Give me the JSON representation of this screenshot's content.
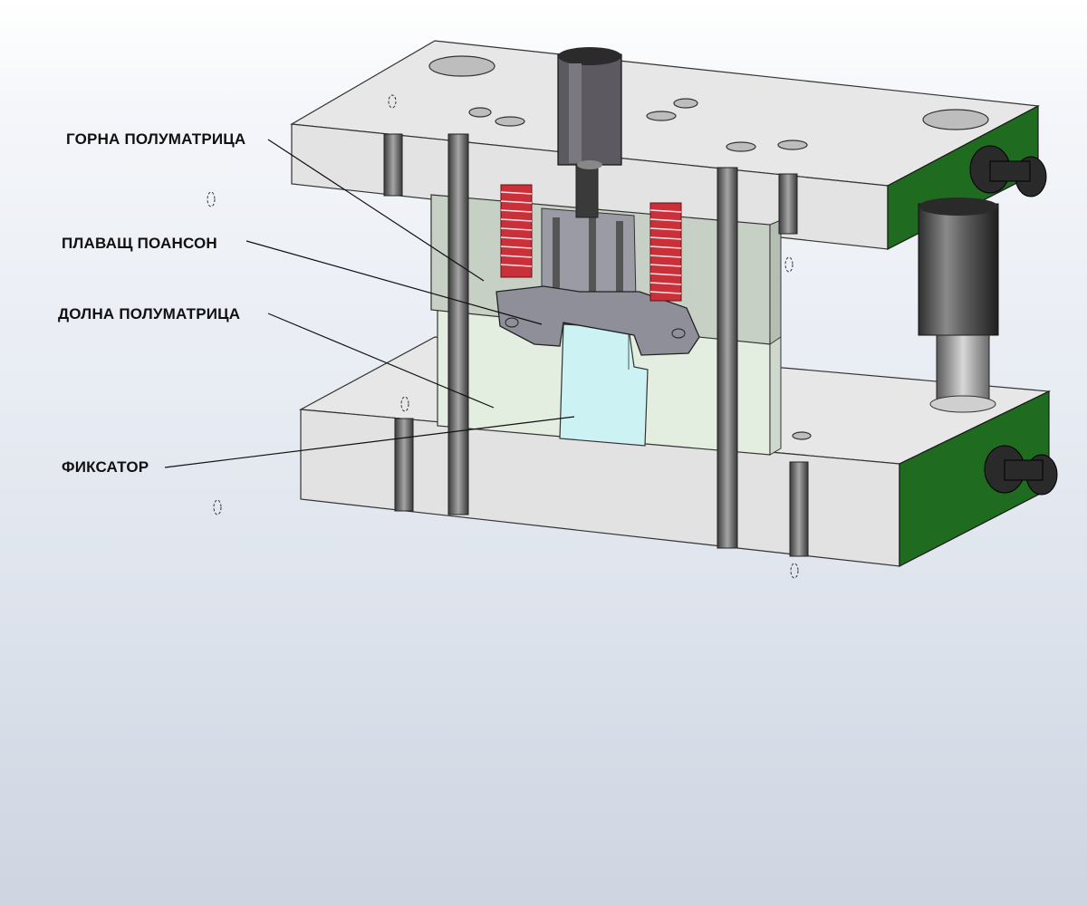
{
  "labels": {
    "upper_half_die": "ГОРНА ПОЛУМАТРИЦА",
    "floating_punch": "ПЛАВАЩ ПОАНСОН",
    "lower_half_die": "ДОЛНА ПОЛУМАТРИЦА",
    "fixator": "ФИКСАТОР"
  },
  "colors": {
    "plate": "#e4e4e4",
    "plate_side": "#d6d6d6",
    "green_face": "#1f6b1f",
    "upper_die_block": "#c7d0c4",
    "lower_die_block": "#e3eee0",
    "punch": "#8f8f9a",
    "fixator_block": "#ccf2f4",
    "spring": "#c9303a",
    "label_text": "#111111"
  }
}
